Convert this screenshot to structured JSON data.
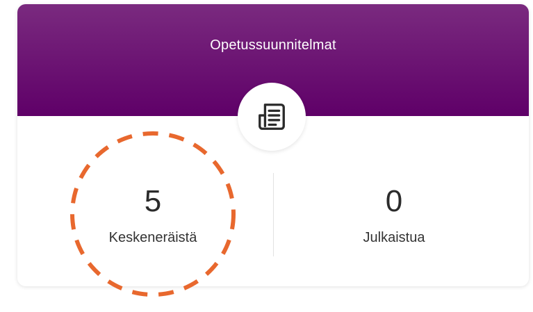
{
  "card": {
    "title": "Opetussuunnitelmat",
    "icon": "document-list-icon",
    "header_color_top": "#7a2a7f",
    "header_color_bottom": "#5f0068"
  },
  "stats": {
    "in_progress": {
      "value": "5",
      "label": "Keskeneräistä"
    },
    "published": {
      "value": "0",
      "label": "Julkaistua"
    }
  },
  "annotation": {
    "shape": "dashed-circle",
    "color": "#e8682e"
  }
}
